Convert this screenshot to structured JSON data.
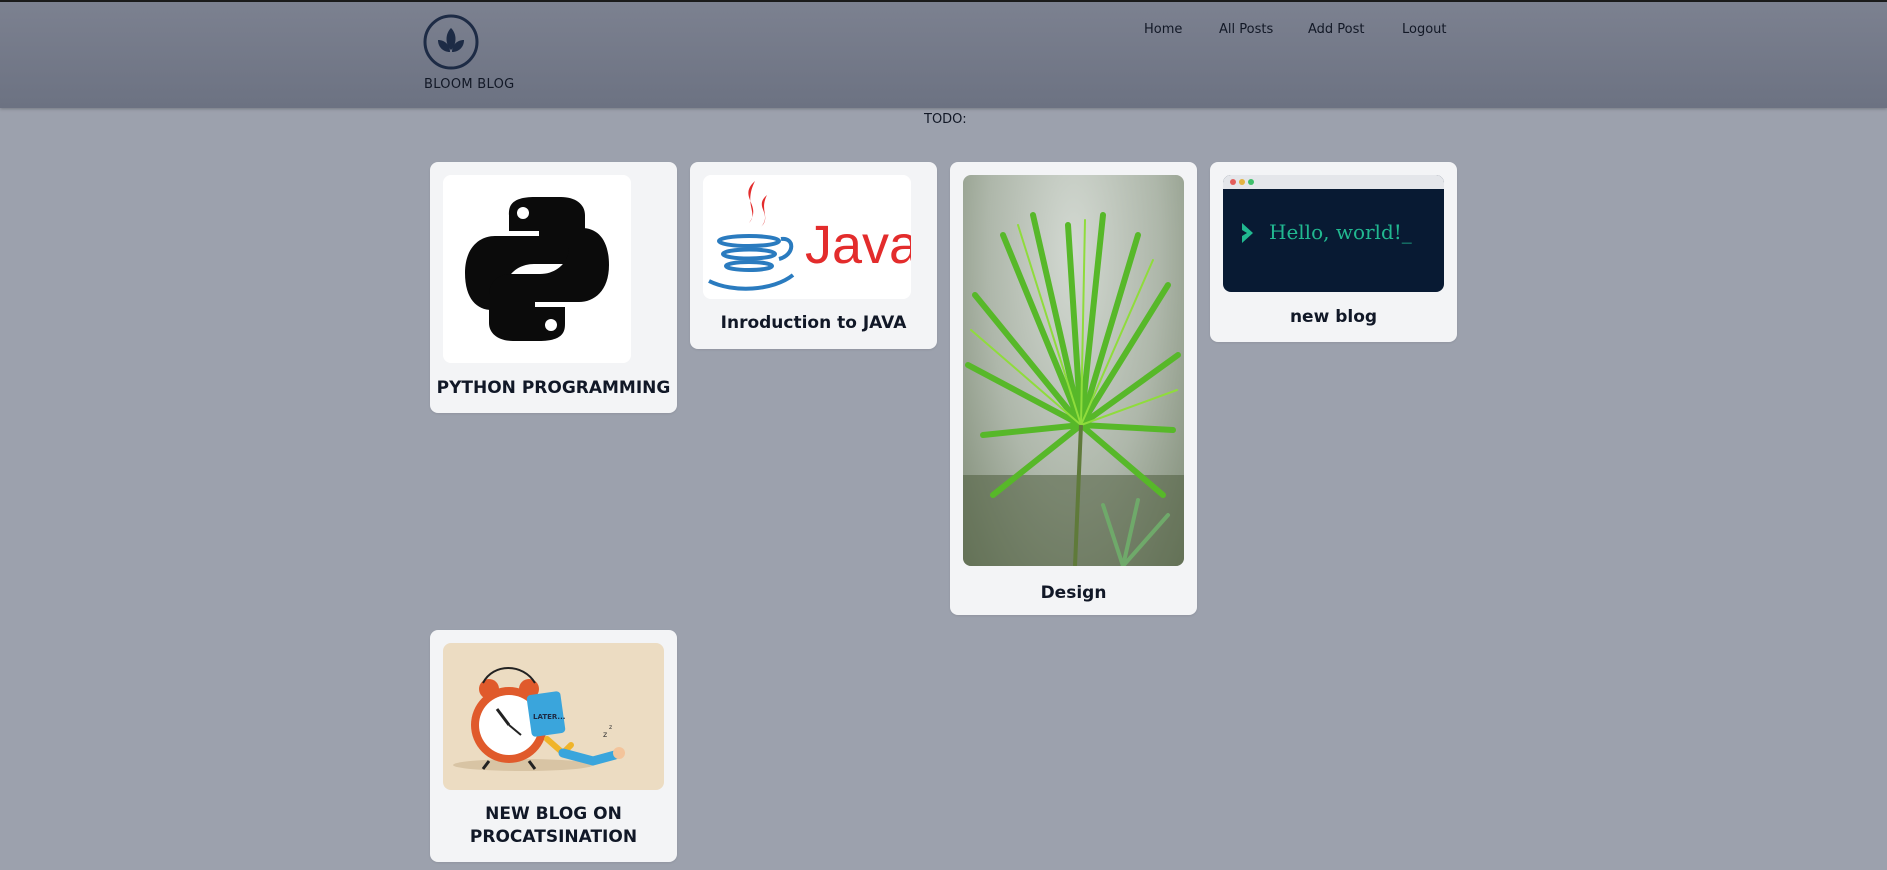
{
  "brand": {
    "name": "BLOOM BLOG"
  },
  "nav": {
    "items": [
      {
        "label": "Home"
      },
      {
        "label": "All Posts"
      },
      {
        "label": "Add Post"
      },
      {
        "label": "Logout"
      }
    ]
  },
  "todo_label": "TODO:",
  "posts": [
    {
      "title": "PYTHON PROGRAMMING",
      "image": "python-logo"
    },
    {
      "title": "Inroduction to JAVA",
      "image": "java-logo",
      "image_text": "Java"
    },
    {
      "title": "Design",
      "image": "palm-leaf-photo"
    },
    {
      "title": "new blog",
      "image": "hello-world-terminal",
      "image_text": "Hello, world!_"
    },
    {
      "title": "NEW BLOG ON PROCATSINATION",
      "image": "procrastination-clock-illustration",
      "image_text": "LATER..."
    }
  ],
  "colors": {
    "background": "#9ca1ad",
    "header": "#6f7585",
    "card": "#f3f4f6",
    "logo": "#1d2b45",
    "java_red": "#e32c2c",
    "java_blue": "#2a7bbf",
    "terminal_bg": "#081a33",
    "terminal_text": "#21b890"
  }
}
